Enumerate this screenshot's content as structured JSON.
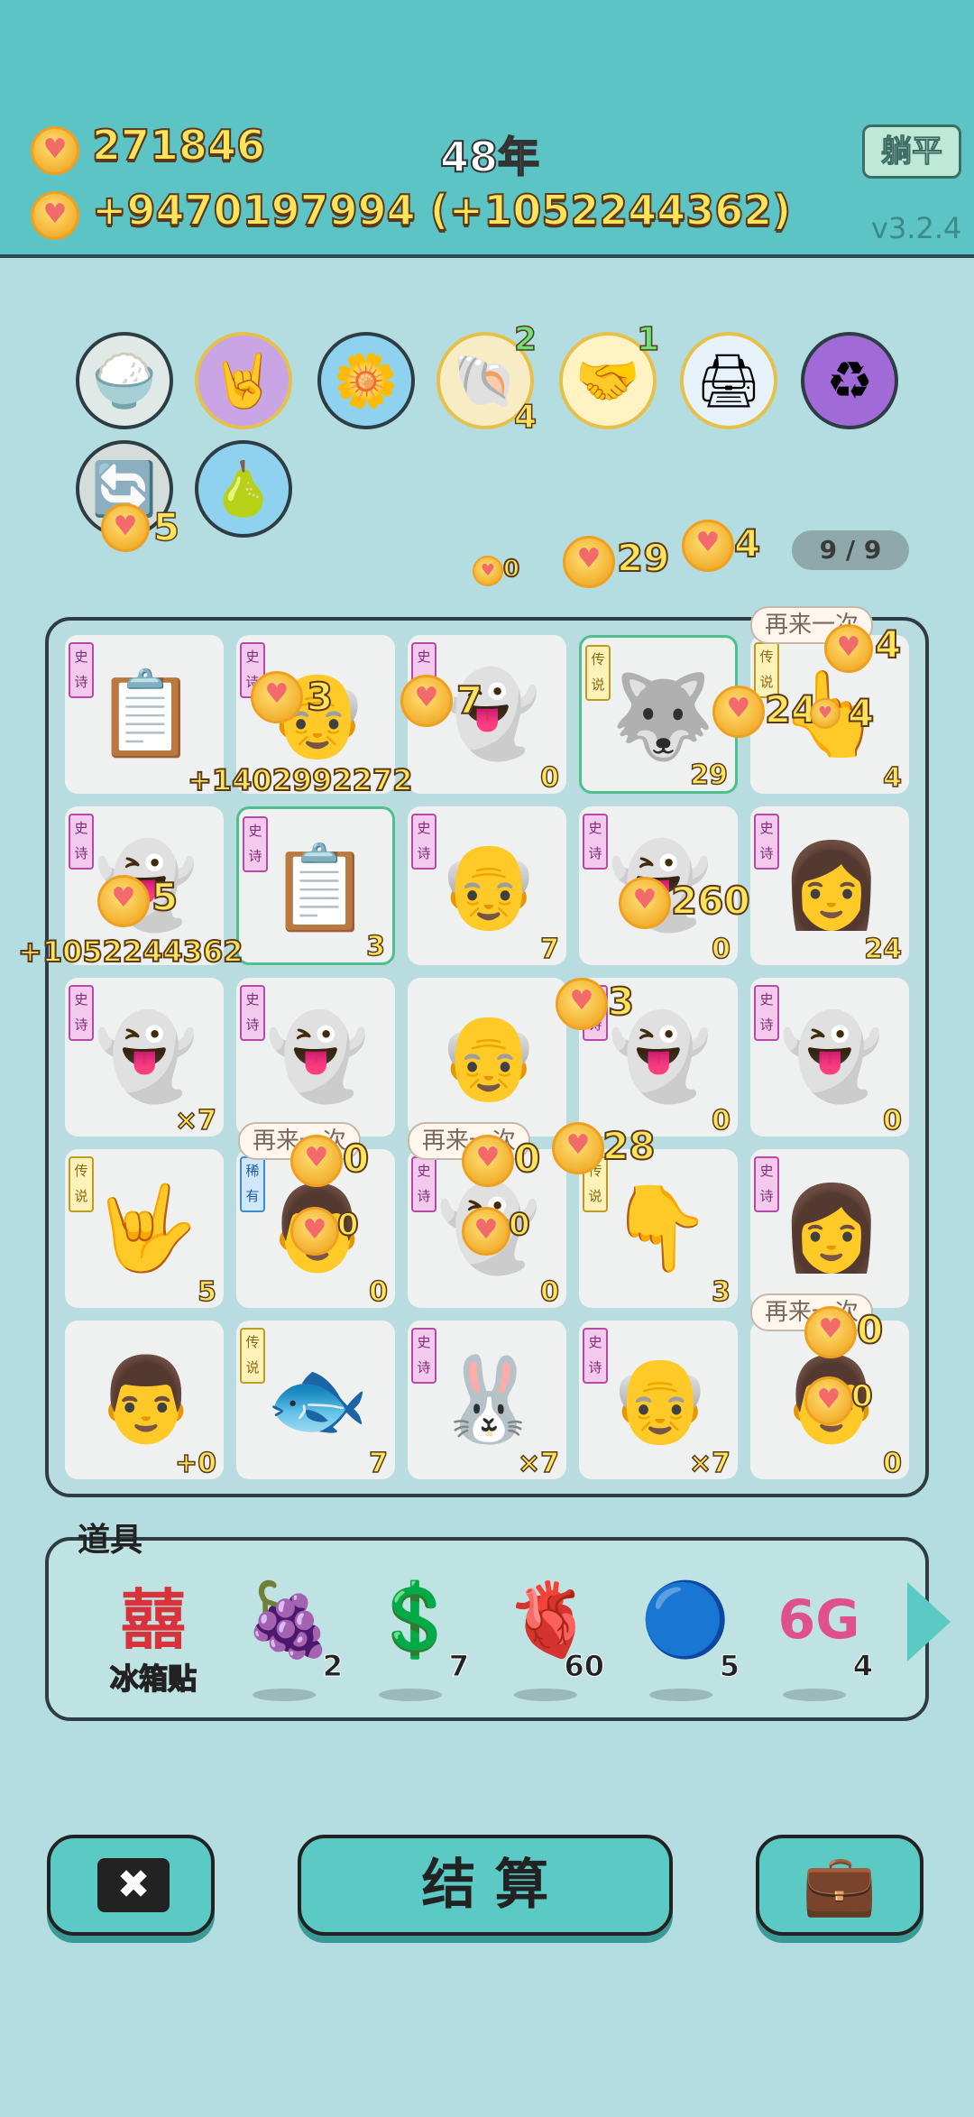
{
  "header": {
    "gold": "271846",
    "income": "+9470197994 (+1052244362)",
    "year": "48年",
    "lie_flat_button": "躺平",
    "version": "v3.2.4"
  },
  "skills": {
    "shell_top": "2",
    "shell_bottom": "4",
    "handshake": "1",
    "refresh_count": "5"
  },
  "floating": {
    "f1": "0",
    "f2": "29",
    "f3": "4",
    "slots": "9 / 9",
    "retry_label": "再来一次",
    "big_income": "+1402992272",
    "side_income": "+1052244362",
    "e_3a": "3",
    "e_7": "7",
    "e_24": "24",
    "e_4a": "4",
    "e_4b": "4",
    "e_5": "5",
    "e_260": "260",
    "e_3b": "3",
    "e_0a": "0",
    "e_0b": "0",
    "e_28": "28",
    "e_0c": "0",
    "e_0d": "0",
    "e_0e": "0",
    "e_0f": "0"
  },
  "board": {
    "rows": [
      [
        {
          "tag": "史诗",
          "art": "📋",
          "count": ""
        },
        {
          "tag": "史诗",
          "art": "👴",
          "count": ""
        },
        {
          "tag": "史诗",
          "art": "👻",
          "count": "0"
        },
        {
          "tag": "传说",
          "art": "🐺",
          "count": "29"
        },
        {
          "tag": "传说",
          "art": "👆",
          "count": "4"
        }
      ],
      [
        {
          "tag": "史诗",
          "art": "👻",
          "count": ""
        },
        {
          "tag": "史诗",
          "art": "📋",
          "count": "3"
        },
        {
          "tag": "史诗",
          "art": "👴",
          "count": "7"
        },
        {
          "tag": "史诗",
          "art": "👻",
          "count": "0"
        },
        {
          "tag": "史诗",
          "art": "👩",
          "count": "24"
        }
      ],
      [
        {
          "tag": "史诗",
          "art": "👻",
          "count": "×7"
        },
        {
          "tag": "史诗",
          "art": "👻",
          "count": ""
        },
        {
          "tag": "",
          "art": "👴",
          "count": ""
        },
        {
          "tag": "史诗",
          "art": "👻",
          "count": "0"
        },
        {
          "tag": "史诗",
          "art": "👻",
          "count": "0"
        }
      ],
      [
        {
          "tag": "传说",
          "art": "🤟",
          "count": "5"
        },
        {
          "tag": "稀有",
          "art": "👨",
          "count": "0"
        },
        {
          "tag": "史诗",
          "art": "👻",
          "count": "0"
        },
        {
          "tag": "传说",
          "art": "👇",
          "count": "3"
        },
        {
          "tag": "史诗",
          "art": "👩",
          "count": ""
        }
      ],
      [
        {
          "tag": "",
          "art": "👨",
          "count": "+0"
        },
        {
          "tag": "传说",
          "art": "🐟",
          "count": "7"
        },
        {
          "tag": "史诗",
          "art": "🐰",
          "count": "×7"
        },
        {
          "tag": "史诗",
          "art": "👴",
          "count": "×7"
        },
        {
          "tag": "",
          "art": "👨",
          "count": "0"
        }
      ]
    ]
  },
  "props": {
    "title": "道具",
    "items": [
      {
        "icon": "囍",
        "label": "冰箱贴",
        "count": ""
      },
      {
        "icon": "🍇",
        "label": "",
        "count": "2"
      },
      {
        "icon": "💲",
        "label": "",
        "count": "7"
      },
      {
        "icon": "🫀",
        "label": "",
        "count": "60"
      },
      {
        "icon": "🔵",
        "label": "",
        "count": "5"
      },
      {
        "icon": "6G",
        "label": "",
        "count": "4"
      }
    ]
  },
  "buttons": {
    "settle": "结 算"
  }
}
